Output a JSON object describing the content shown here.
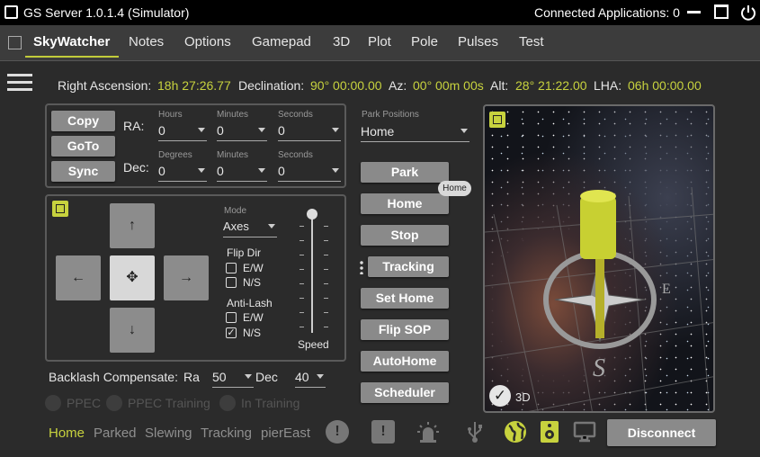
{
  "window": {
    "title": "GS Server 1.0.1.4 (Simulator)",
    "connected": "Connected Applications: 0"
  },
  "tabs": [
    "SkyWatcher",
    "Notes",
    "Options",
    "Gamepad",
    "3D",
    "Plot",
    "Pole",
    "Pulses",
    "Test"
  ],
  "coords": {
    "ra_label": "Right Ascension:",
    "ra": "18h 27:26.77",
    "dec_label": "Declination:",
    "dec": "90° 00:00.00",
    "az_label": "Az:",
    "az": "00° 00m 00s",
    "alt_label": "Alt:",
    "alt": "28° 21:22.00",
    "lha_label": "LHA:",
    "lha": "06h 00:00.00"
  },
  "goto": {
    "copy": "Copy",
    "goto": "GoTo",
    "sync": "Sync",
    "ra": "RA:",
    "dec": "Dec:",
    "hours": "Hours",
    "minutes": "Minutes",
    "seconds": "Seconds",
    "degrees": "Degrees",
    "zero": "0"
  },
  "park": {
    "label": "Park Positions",
    "value": "Home"
  },
  "buttons": {
    "park": "Park",
    "home": "Home",
    "stop": "Stop",
    "tracking": "Tracking",
    "sethome": "Set Home",
    "flipsop": "Flip SOP",
    "autohome": "AutoHome",
    "scheduler": "Scheduler",
    "tooltip": "Home"
  },
  "hand": {
    "mode_label": "Mode",
    "mode": "Axes",
    "flipdir": "Flip Dir",
    "ew": "E/W",
    "ns": "N/S",
    "antilash": "Anti-Lash",
    "speed": "Speed"
  },
  "backlash": {
    "label": "Backlash Compensate:",
    "ra": "Ra",
    "ra_val": "50",
    "dec": "Dec",
    "dec_val": "40"
  },
  "ppec": {
    "ppec": "PPEC",
    "training": "PPEC Training",
    "in_training": "In Training"
  },
  "scene": {
    "label3d": "3D"
  },
  "status": {
    "home": "Home",
    "parked": "Parked",
    "slewing": "Slewing",
    "tracking": "Tracking",
    "pier": "pierEast",
    "disconnect": "Disconnect"
  },
  "colors": {
    "accent": "#c7d23e",
    "button": "#8a8a8a"
  }
}
